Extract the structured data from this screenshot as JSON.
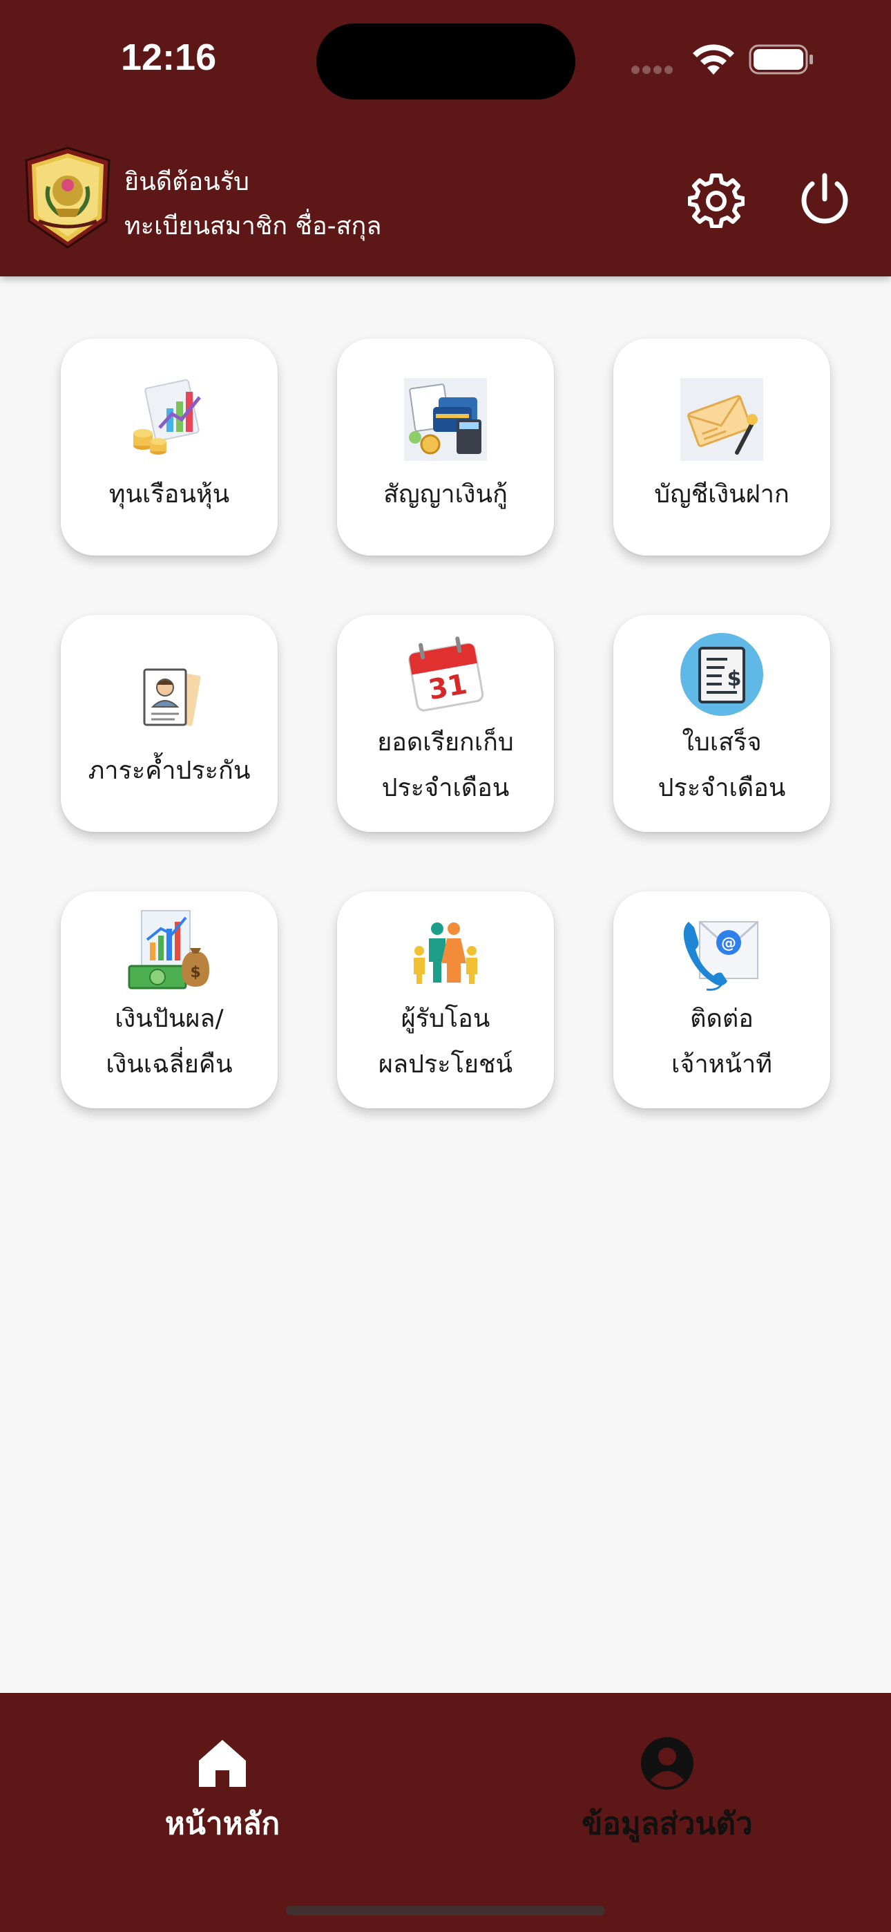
{
  "status_bar": {
    "time": "12:16",
    "icons": [
      "cellular-signal-icon",
      "wifi-icon",
      "battery-icon"
    ]
  },
  "header": {
    "greeting": "ยินดีต้อนรับ",
    "member_name": "ทะเบียนสมาชิก ชื่อ-สกุล",
    "logo_icon": "cooperative-emblem-logo",
    "actions": [
      "settings-gear-icon",
      "power-logout-icon"
    ],
    "background_color": "#5c1716"
  },
  "menu": {
    "tiles": [
      {
        "label": "ทุนเรือนหุ้น",
        "icon": "share-capital-chart-coins-icon"
      },
      {
        "label": "สัญญาเงินกู้",
        "icon": "loan-contract-cards-calculator-icon"
      },
      {
        "label": "บัญชีเงินฝาก",
        "icon": "deposit-account-envelope-icon"
      },
      {
        "label": "ภาระค้ำประกัน",
        "icon": "guarantor-profile-document-icon"
      },
      {
        "label": "ยอดเรียกเก็บ\nประจำเดือน",
        "icon": "calendar-31-icon"
      },
      {
        "label": "ใบเสร็จ\nประจำเดือน",
        "icon": "receipt-dollar-icon"
      },
      {
        "label": "เงินปันผล/\nเงินเฉลี่ยคืน",
        "icon": "dividend-chart-money-bag-icon"
      },
      {
        "label": "ผู้รับโอน\nผลประโยชน์",
        "icon": "family-beneficiary-icon"
      },
      {
        "label": "ติดต่อ\nเจ้าหน้าที",
        "icon": "contact-phone-email-icon"
      }
    ]
  },
  "bottom_nav": {
    "items": [
      {
        "label": "หน้าหลัก",
        "icon": "home-icon",
        "active": true
      },
      {
        "label": "ข้อมูลส่วนตัว",
        "icon": "account-circle-icon",
        "active": false
      }
    ],
    "active_color": "#ffffff",
    "inactive_color": "#111111"
  }
}
